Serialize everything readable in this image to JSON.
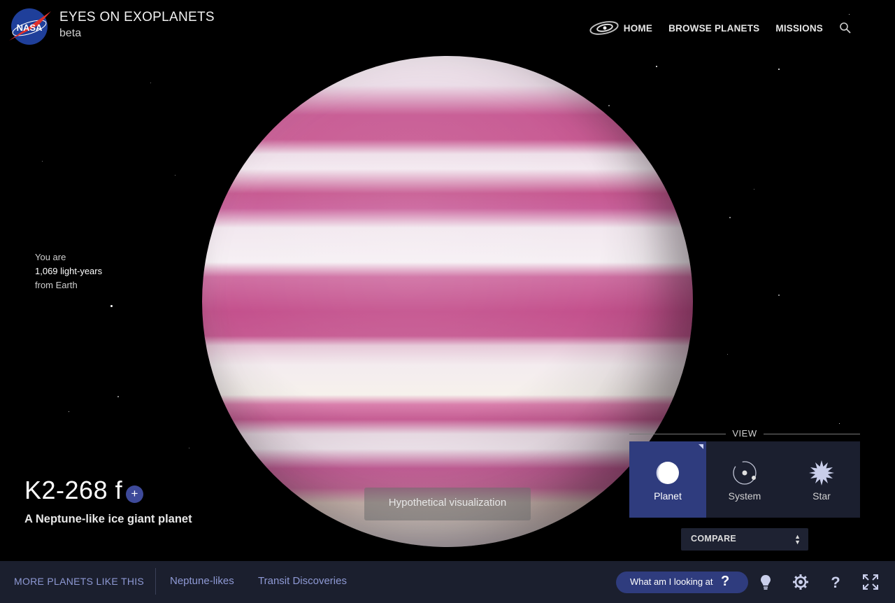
{
  "header": {
    "logo_text": "NASA",
    "title": "EYES ON EXOPLANETS",
    "subtitle": "beta",
    "nav": [
      {
        "label": "HOME",
        "icon": "galaxy-icon"
      },
      {
        "label": "BROWSE PLANETS"
      },
      {
        "label": "MISSIONS"
      }
    ],
    "search_icon": "search-icon"
  },
  "distance": {
    "line1": "You are",
    "line2": "1,069 light-years",
    "line3": "from Earth"
  },
  "planet": {
    "name": "K2-268 f",
    "add_label": "+",
    "description": "A Neptune-like ice giant planet",
    "visualization_note": "Hypothetical visualization"
  },
  "view": {
    "label": "VIEW",
    "options": [
      {
        "label": "Planet",
        "icon": "planet-icon",
        "active": true
      },
      {
        "label": "System",
        "icon": "system-icon",
        "active": false
      },
      {
        "label": "Star",
        "icon": "star-icon",
        "active": false
      }
    ],
    "compare_label": "COMPARE"
  },
  "bottombar": {
    "more_label": "MORE PLANETS LIKE THIS",
    "categories": [
      "Neptune-likes",
      "Transit Discoveries"
    ],
    "what_label": "What am I looking at",
    "what_icon": "question-icon",
    "icons": [
      "lightbulb-icon",
      "settings-gear-icon",
      "help-icon",
      "fullscreen-icon"
    ]
  },
  "colors": {
    "accent": "#2f3c7e",
    "bar": "#1b1f2e",
    "link": "#8e99d4"
  }
}
